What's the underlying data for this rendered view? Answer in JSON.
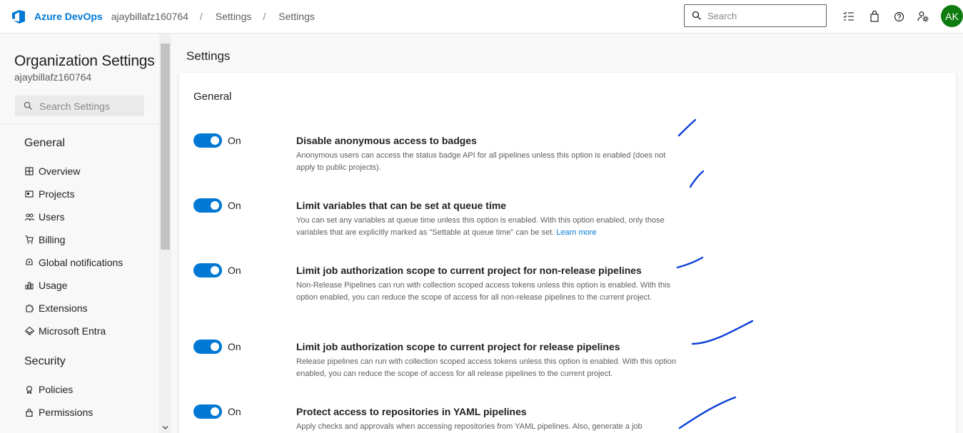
{
  "topbar": {
    "brand": "Azure DevOps",
    "breadcrumbs": [
      "ajaybillafz160764",
      "Settings",
      "Settings"
    ],
    "separator": "/",
    "search_placeholder": "Search",
    "avatar_initials": "AK",
    "avatar_color": "#107c10",
    "icons": [
      "task-list-icon",
      "shopping-bag-icon",
      "help-icon",
      "user-settings-icon"
    ]
  },
  "sidebar": {
    "title": "Organization Settings",
    "subtitle": "ajaybillafz160764",
    "search_placeholder": "Search Settings",
    "sections": [
      {
        "heading": "General",
        "items": [
          {
            "label": "Overview",
            "icon": "overview-icon"
          },
          {
            "label": "Projects",
            "icon": "projects-icon"
          },
          {
            "label": "Users",
            "icon": "users-icon"
          },
          {
            "label": "Billing",
            "icon": "billing-icon"
          },
          {
            "label": "Global notifications",
            "icon": "notifications-icon"
          },
          {
            "label": "Usage",
            "icon": "usage-icon"
          },
          {
            "label": "Extensions",
            "icon": "extensions-icon"
          },
          {
            "label": "Microsoft Entra",
            "icon": "entra-icon"
          }
        ]
      },
      {
        "heading": "Security",
        "items": [
          {
            "label": "Policies",
            "icon": "policies-icon"
          },
          {
            "label": "Permissions",
            "icon": "permissions-icon"
          }
        ]
      }
    ]
  },
  "main": {
    "page_title": "Settings",
    "card_heading": "General",
    "accent_color": "#0078d4",
    "settings": [
      {
        "state": "On",
        "title": "Disable anonymous access to badges",
        "description": "Anonymous users can access the status badge API for all pipelines unless this option is enabled (does not apply to public projects)."
      },
      {
        "state": "On",
        "title": "Limit variables that can be set at queue time",
        "description": "You can set any variables at queue time unless this option is enabled. With this option enabled, only those variables that are explicitly marked as \"Settable at queue time\" can be set.",
        "link": "Learn more"
      },
      {
        "state": "On",
        "title": "Limit job authorization scope to current project for non-release pipelines",
        "description": "Non-Release Pipelines can run with collection scoped access tokens unless this option is enabled. With this option enabled, you can reduce the scope of access for all non-release pipelines to the current project."
      },
      {
        "state": "On",
        "title": "Limit job authorization scope to current project for release pipelines",
        "description": "Release pipelines can run with collection scoped access tokens unless this option is enabled. With this option enabled, you can reduce the scope of access for all release pipelines to the current project."
      },
      {
        "state": "On",
        "title": "Protect access to repositories in YAML pipelines",
        "description": "Apply checks and approvals when accessing repositories from YAML pipelines. Also, generate a job"
      }
    ],
    "annotation_color": "#0a3fd6"
  }
}
